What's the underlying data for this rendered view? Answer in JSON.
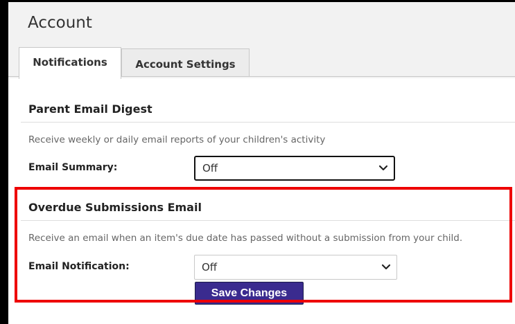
{
  "page": {
    "title": "Account"
  },
  "tabs": [
    {
      "label": "Notifications",
      "active": true
    },
    {
      "label": "Account Settings",
      "active": false
    }
  ],
  "parent_digest": {
    "title": "Parent Email Digest",
    "description": "Receive weekly or daily email reports of your children's activity",
    "field_label": "Email Summary:",
    "selected": "Off"
  },
  "overdue": {
    "title": "Overdue Submissions Email",
    "description": "Receive an email when an item's due date has passed without a submission from your child.",
    "field_label": "Email Notification:",
    "selected": "Off"
  },
  "actions": {
    "save_label": "Save Changes"
  },
  "colors": {
    "button": "#3a2b8f",
    "highlight": "#ee0000",
    "header_bg": "#f2f2f2"
  },
  "icons": {
    "select_chevron": "chevron-down-icon"
  }
}
